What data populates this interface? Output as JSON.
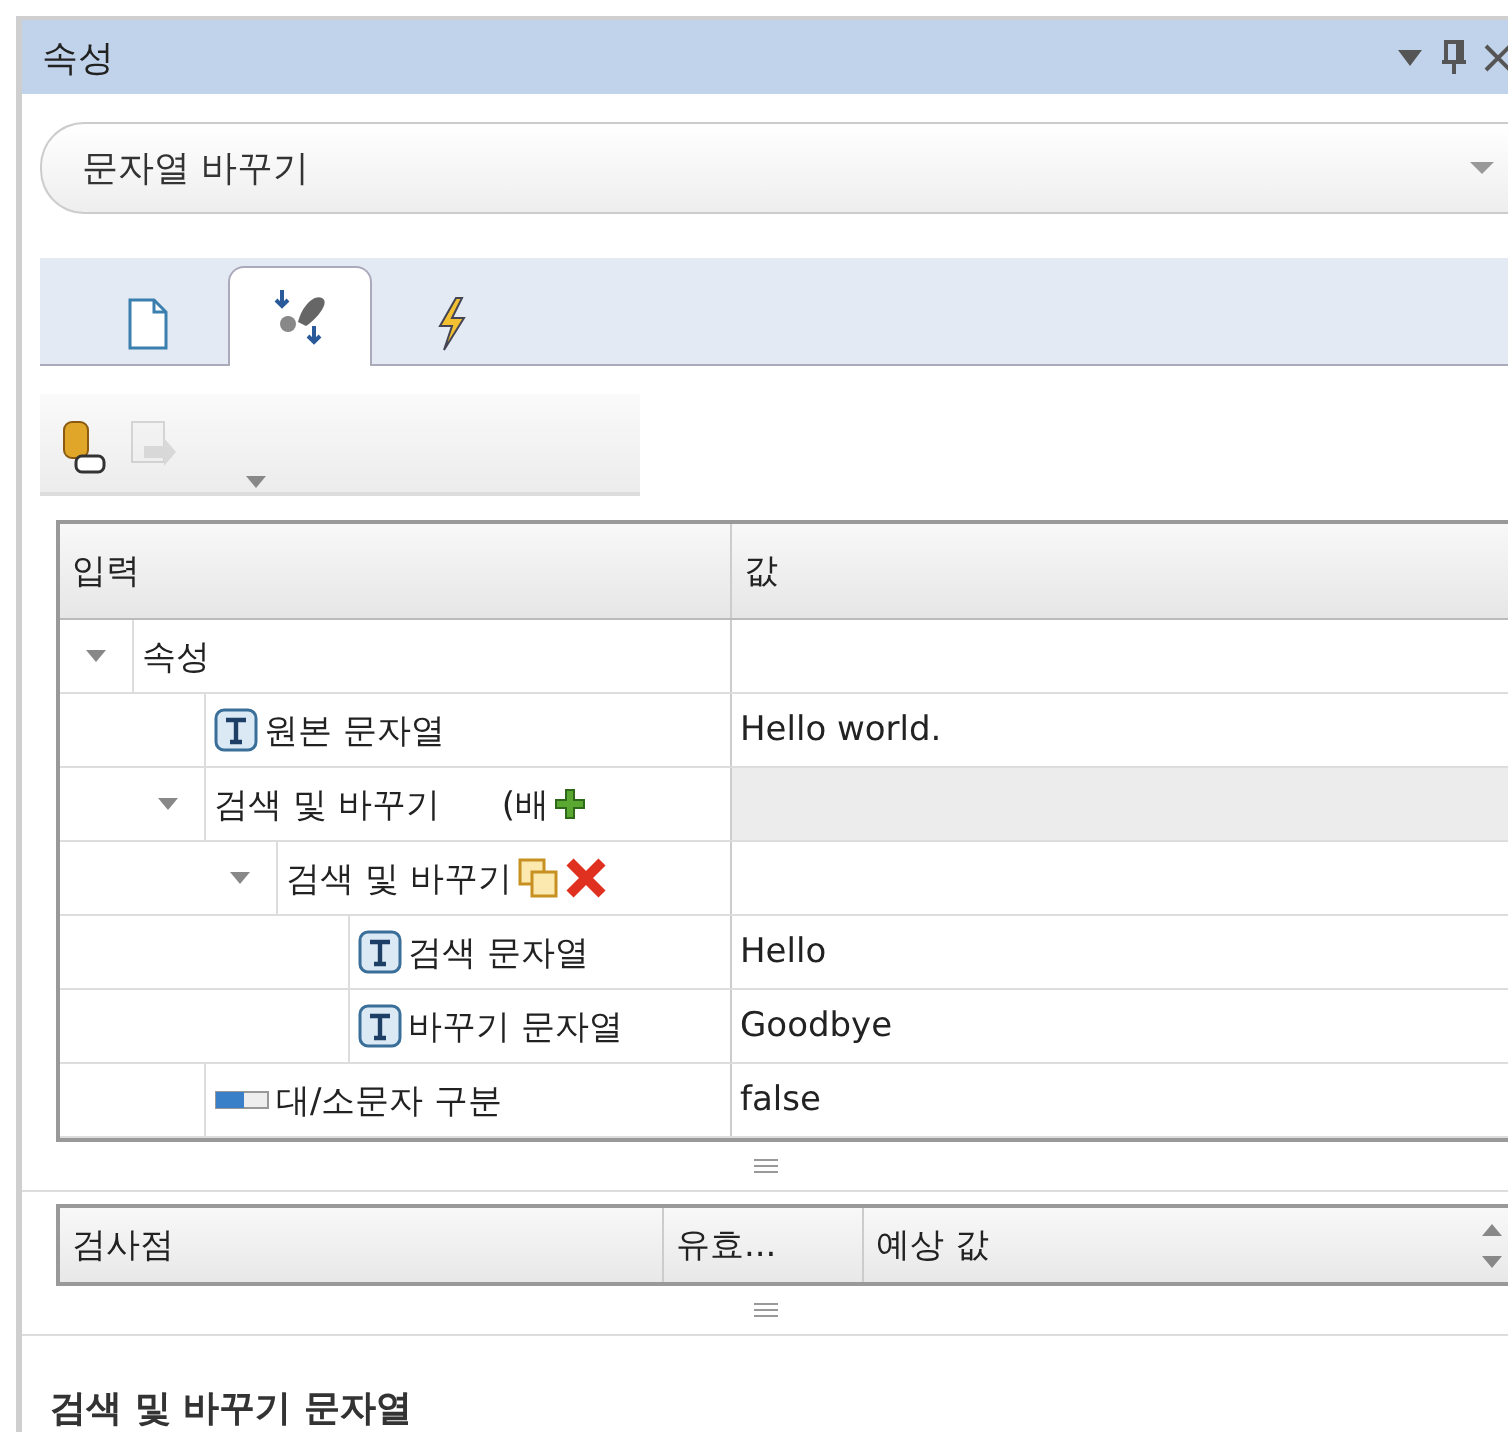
{
  "panel": {
    "title": "속성"
  },
  "object_selector": {
    "value": "문자열 바꾸기"
  },
  "tabs": [
    {
      "kind": "page",
      "selected": false
    },
    {
      "kind": "steps",
      "selected": true
    },
    {
      "kind": "events",
      "selected": false
    }
  ],
  "toolbar": [
    {
      "kind": "data-link",
      "disabled": false
    },
    {
      "kind": "import",
      "disabled": true
    }
  ],
  "grid": {
    "columns": [
      "입력",
      "값"
    ],
    "rows": [
      {
        "kind": "category",
        "label": "속성",
        "expanded": true,
        "children": [
          {
            "kind": "text",
            "label": "원본 문자열",
            "value": "Hello world."
          },
          {
            "kind": "collection",
            "label": "검색 및 바꾸기",
            "suffix": "(배",
            "expanded": true,
            "children": [
              {
                "kind": "item",
                "label": "검색 및 바꾸기",
                "expanded": true,
                "children": [
                  {
                    "kind": "text",
                    "label": "검색 문자열",
                    "value": "Hello"
                  },
                  {
                    "kind": "text",
                    "label": "바꾸기 문자열",
                    "value": "Goodbye"
                  }
                ]
              }
            ]
          },
          {
            "kind": "boolean",
            "label": "대/소문자 구분",
            "value": "false"
          }
        ]
      }
    ]
  },
  "checkpoints": {
    "columns": [
      "검사점",
      "유효...",
      "예상 값"
    ]
  },
  "description": {
    "title": "검색 및 바꾸기 문자열"
  }
}
